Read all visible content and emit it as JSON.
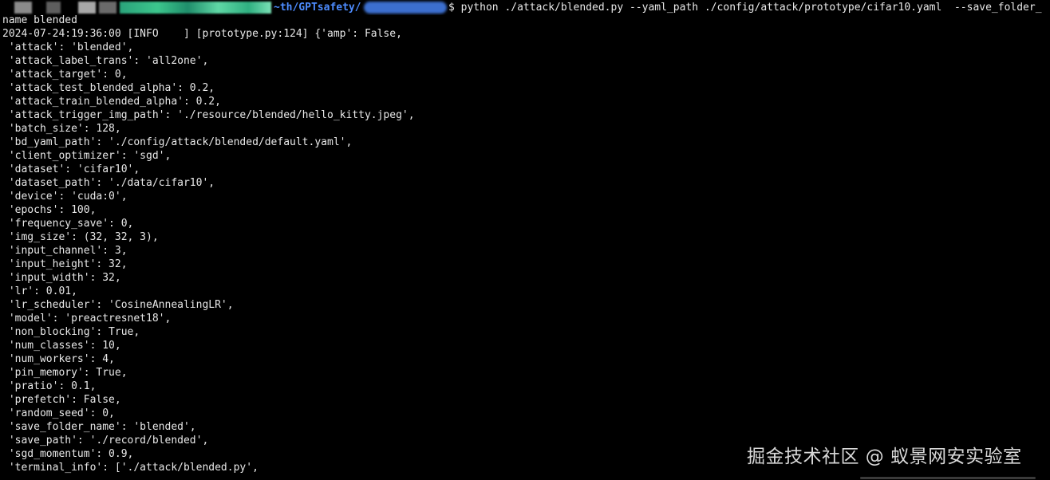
{
  "prompt": {
    "path": "~th/GPTsafety/",
    "command": "$ python ./attack/blended.py --yaml_path ./config/attack/prototype/cifar10.yaml  --save_folder_"
  },
  "lines": [
    "name blended",
    "2024-07-24:19:36:00 [INFO    ] [prototype.py:124] {'amp': False,",
    " 'attack': 'blended',",
    " 'attack_label_trans': 'all2one',",
    " 'attack_target': 0,",
    " 'attack_test_blended_alpha': 0.2,",
    " 'attack_train_blended_alpha': 0.2,",
    " 'attack_trigger_img_path': './resource/blended/hello_kitty.jpeg',",
    " 'batch_size': 128,",
    " 'bd_yaml_path': './config/attack/blended/default.yaml',",
    " 'client_optimizer': 'sgd',",
    " 'dataset': 'cifar10',",
    " 'dataset_path': './data/cifar10',",
    " 'device': 'cuda:0',",
    " 'epochs': 100,",
    " 'frequency_save': 0,",
    " 'img_size': (32, 32, 3),",
    " 'input_channel': 3,",
    " 'input_height': 32,",
    " 'input_width': 32,",
    " 'lr': 0.01,",
    " 'lr_scheduler': 'CosineAnnealingLR',",
    " 'model': 'preactresnet18',",
    " 'non_blocking': True,",
    " 'num_classes': 10,",
    " 'num_workers': 4,",
    " 'pin_memory': True,",
    " 'pratio': 0.1,",
    " 'prefetch': False,",
    " 'random_seed': 0,",
    " 'save_folder_name': 'blended',",
    " 'save_path': './record/blended',",
    " 'sgd_momentum': 0.9,",
    " 'terminal_info': ['./attack/blended.py',"
  ],
  "watermark": "掘金技术社区 @ 蚁景网安实验室"
}
